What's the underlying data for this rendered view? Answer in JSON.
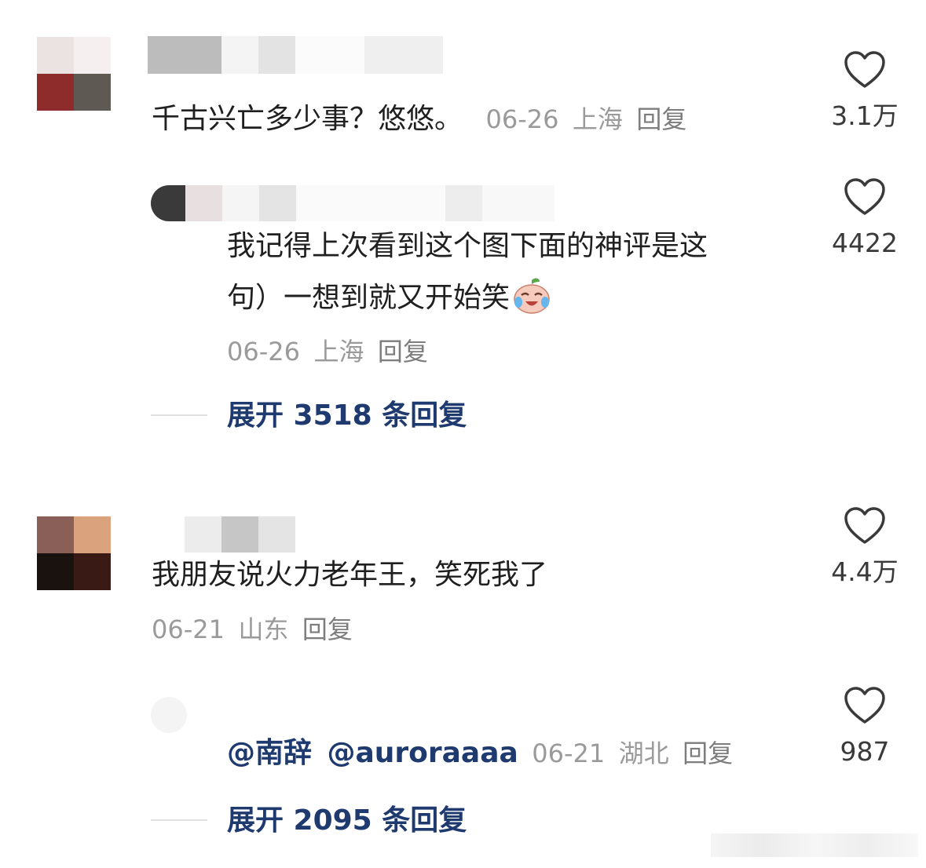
{
  "comments": [
    {
      "text": "千古兴亡多少事？悠悠。",
      "date": "06-26",
      "location": "上海",
      "reply_label": "回复",
      "likes": "3.1万",
      "replies": [
        {
          "text_line1": "我记得上次看到这个图下面的神评是这",
          "text_line2": "句）一想到就又开始笑",
          "emoji": "crying-laughing-emoji-icon",
          "date": "06-26",
          "location": "上海",
          "reply_label": "回复",
          "likes": "4422"
        }
      ],
      "expand_label": "展开 3518 条回复"
    },
    {
      "text": "我朋友说火力老年王，笑死我了",
      "date": "06-21",
      "location": "山东",
      "reply_label": "回复",
      "likes": "4.4万",
      "replies": [
        {
          "mention1": "@南辞",
          "mention2": "@auroraaaa",
          "date": "06-21",
          "location": "湖北",
          "reply_label": "回复",
          "likes": "987"
        }
      ],
      "expand_label": "展开 2095 条回复"
    }
  ],
  "colors": {
    "link": "#1e3a6e",
    "meta": "#9a9a9a",
    "heart_outline": "#3a3a3a"
  }
}
